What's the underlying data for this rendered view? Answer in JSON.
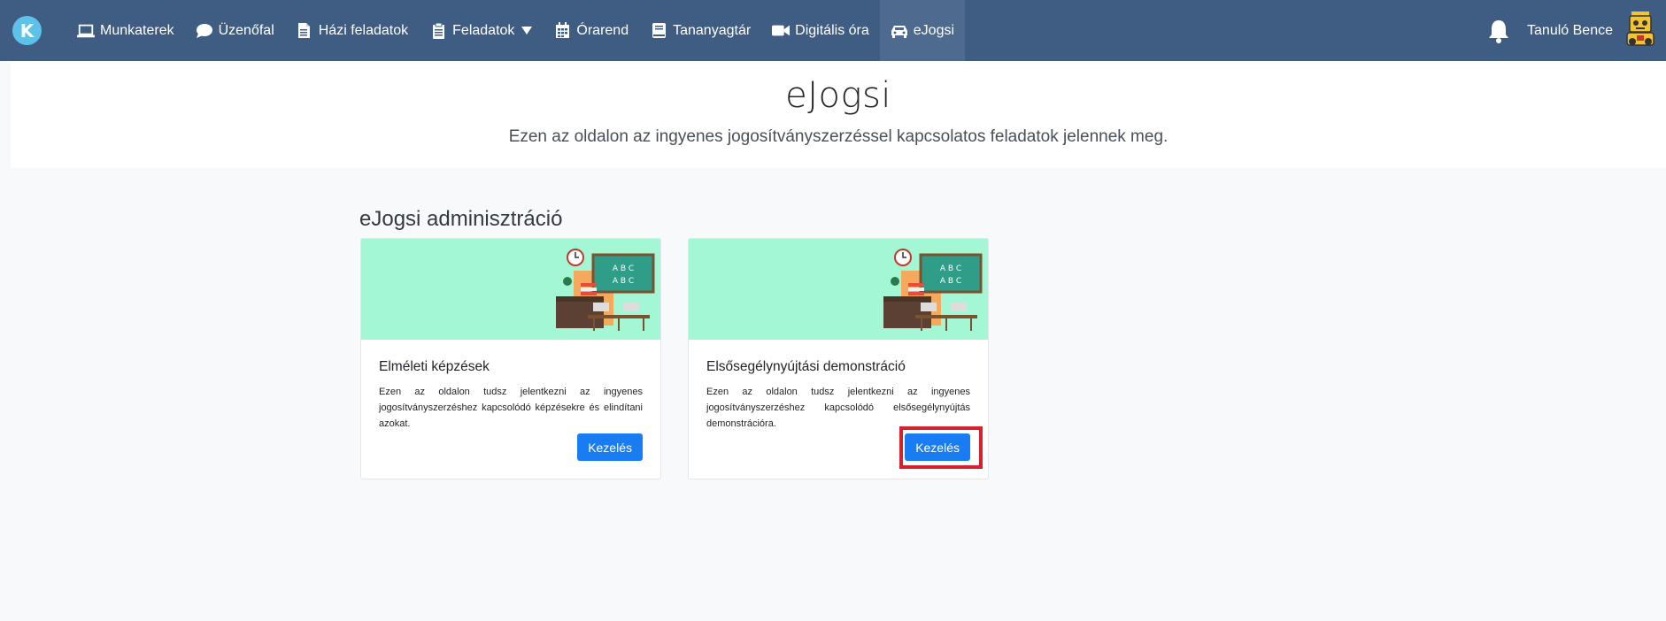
{
  "nav": {
    "logo_letter": "K",
    "items": [
      {
        "label": "Munkaterek",
        "icon": "laptop-icon"
      },
      {
        "label": "Üzenőfal",
        "icon": "speech-bubble-icon"
      },
      {
        "label": "Házi feladatok",
        "icon": "document-icon"
      },
      {
        "label": "Feladatok",
        "icon": "clipboard-icon"
      },
      {
        "label": "Órarend",
        "icon": "calendar-icon"
      },
      {
        "label": "Tananyagtár",
        "icon": "book-icon"
      },
      {
        "label": "Digitális óra",
        "icon": "video-camera-icon"
      },
      {
        "label": "eJogsi",
        "icon": "car-icon"
      }
    ],
    "user_name": "Tanuló Bence"
  },
  "header": {
    "title": "eJogsi",
    "subtitle": "Ezen az oldalon az ingyenes jogosítványszerzéssel kapcsolatos feladatok jelennek meg."
  },
  "section": {
    "title": "eJogsi adminisztráció"
  },
  "cards": [
    {
      "title": "Elméleti képzések",
      "text": "Ezen az oldalon tudsz jelentkezni az ingyenes jogosítványszerzéshez kapcsolódó képzésekre és elindítani azokat.",
      "button": "Kezelés",
      "board_text_1": "A B C",
      "board_text_2": "A B C"
    },
    {
      "title": "Elsősegélynyújtási demonstráció",
      "text": "Ezen az oldalon tudsz jelentkezni az ingyenes jogosítványszerzéshez kapcsolódó elsősegélynyújtás demonstrációra.",
      "button": "Kezelés",
      "board_text_1": "A B C",
      "board_text_2": "A B C"
    }
  ],
  "colors": {
    "navbar": "#3f5d82",
    "button": "#1a7cf2",
    "card_image_bg": "#a3f7d4",
    "highlight": "#d6202c"
  }
}
